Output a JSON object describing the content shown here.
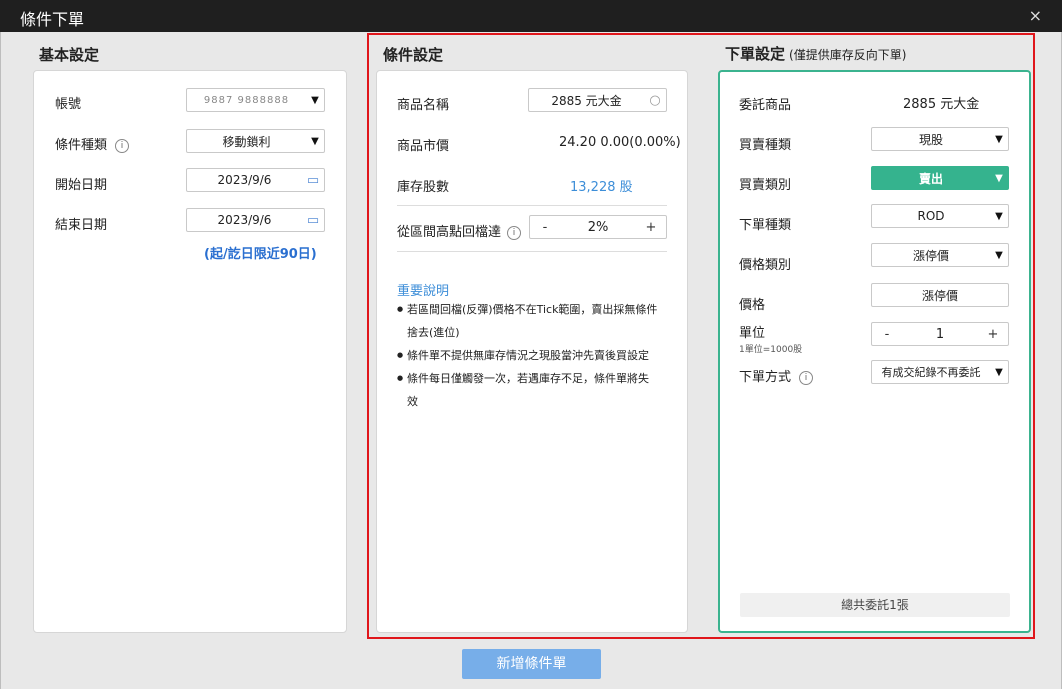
{
  "window": {
    "title": "條件下單",
    "close": "×"
  },
  "basic": {
    "title": "基本設定",
    "account_label": "帳號",
    "account_value": "9887 9888888",
    "cond_type_label": "條件種類",
    "cond_type_value": "移動鎖利",
    "start_label": "開始日期",
    "start_value": "2023/9/6",
    "end_label": "結束日期",
    "end_value": "2023/9/6",
    "range_note": "(起/訖日限近90日)"
  },
  "condition": {
    "title": "條件設定",
    "product_label": "商品名稱",
    "product_value": "2885 元大金",
    "price_label": "商品市價",
    "price_value": "24.20  0.00(0.00%)",
    "stock_label": "庫存股數",
    "stock_value": "13,228 股",
    "pullback_label": "從區間高點回檔達",
    "pullback_minus": "-",
    "pullback_value": "2%",
    "pullback_plus": "+",
    "notes_title": "重要說明",
    "notes": [
      "若區間回檔(反彈)價格不在Tick範圍，賣出採無條件",
      "捨去(進位)",
      "條件單不提供無庫存情況之現股當沖先賣後買設定",
      "條件每日僅觸發一次，若遇庫存不足，條件單將失",
      "效"
    ]
  },
  "order": {
    "title": "下單設定",
    "subtitle": "(僅提供庫存反向下單)",
    "product_label": "委託商品",
    "product_value": "2885 元大金",
    "trade_type_label": "買賣種類",
    "trade_type_value": "現股",
    "side_label": "買賣類別",
    "side_value": "賣出",
    "order_type_label": "下單種類",
    "order_type_value": "ROD",
    "price_type_label": "價格類別",
    "price_type_value": "漲停價",
    "price_label": "價格",
    "price_value": "漲停價",
    "unit_label": "單位",
    "unit_hint": "1單位=1000股",
    "unit_minus": "-",
    "unit_value": "1",
    "unit_plus": "+",
    "method_label": "下單方式",
    "method_value": "有成交紀錄不再委託",
    "total": "總共委託1張"
  },
  "submit_label": "新增條件單",
  "icons": {
    "info": "i",
    "caret": "▼",
    "calendar": "▭",
    "search": "○"
  },
  "colors": {
    "accent_green": "#35b38e",
    "highlight_red": "#e0161b",
    "submit_blue": "#77aee9",
    "link_blue": "#3d8ed8"
  }
}
